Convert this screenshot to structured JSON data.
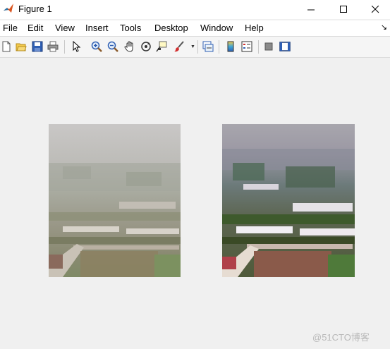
{
  "window": {
    "title": "Figure 1",
    "controls": {
      "minimize": "—",
      "maximize": "☐",
      "close": "✕"
    }
  },
  "menu": {
    "items": [
      "File",
      "Edit",
      "View",
      "Insert",
      "Tools",
      "Desktop",
      "Window",
      "Help"
    ],
    "dock_arrow": "↘"
  },
  "toolbar": {
    "buttons": [
      "new-figure-icon",
      "open-file-icon",
      "save-icon",
      "print-icon",
      "edit-plot-arrow-icon",
      "zoom-in-icon",
      "zoom-out-icon",
      "pan-hand-icon",
      "rotate-3d-icon",
      "data-cursor-icon",
      "brush-icon",
      "link-plot-icon",
      "colorbar-icon",
      "legend-icon",
      "hide-plot-tools-icon",
      "show-plot-tools-icon"
    ]
  },
  "figure": {
    "images": [
      "hazy-aerial-image",
      "dehazed-aerial-image"
    ]
  },
  "watermark": "@51CTO博客"
}
